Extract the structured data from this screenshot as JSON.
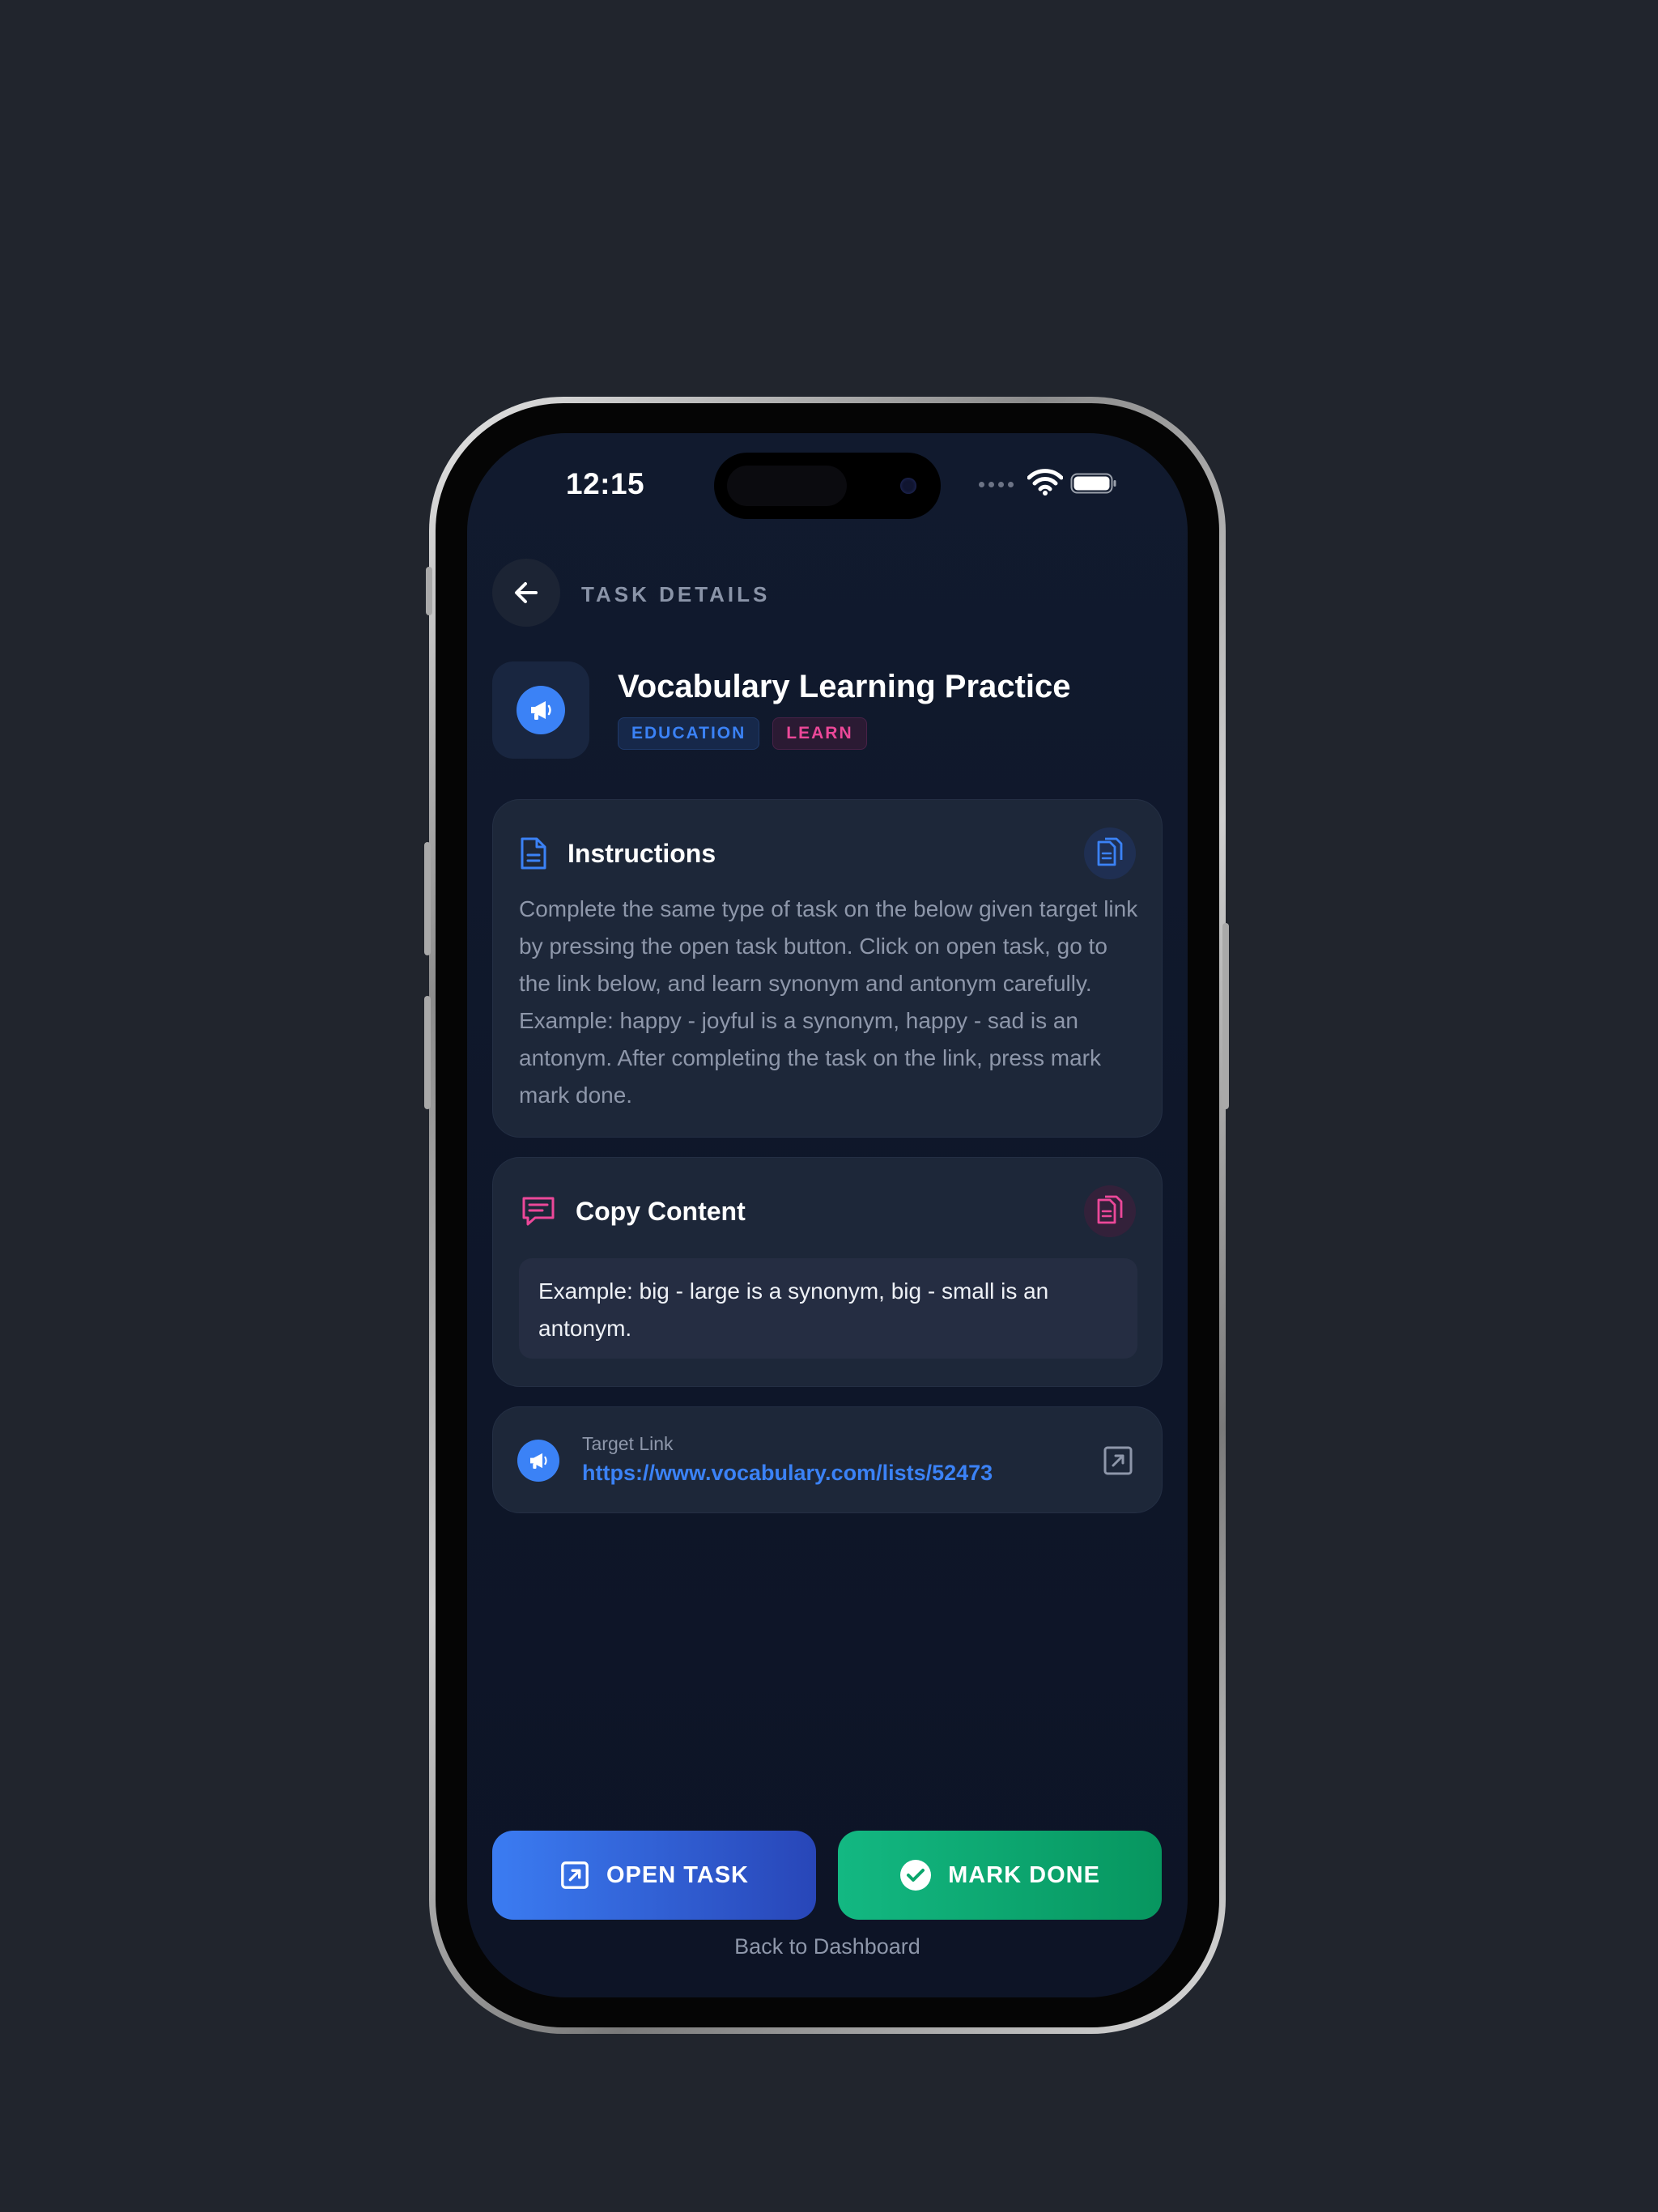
{
  "status_bar": {
    "time": "12:15"
  },
  "header": {
    "label": "TASK DETAILS"
  },
  "task": {
    "title": "Vocabulary Learning Practice",
    "tags": [
      "EDUCATION",
      "LEARN"
    ]
  },
  "instructions": {
    "title": "Instructions",
    "text": "Complete the same type of task on the below given target link by pressing the open task button. Click on open task, go to the link below, and learn synonym and antonym carefully. Example: happy - joyful is a synonym, happy - sad is an antonym. After completing the task on the link, press mark mark done."
  },
  "copy_content": {
    "title": "Copy Content",
    "text": "Example: big - large is a synonym, big - small is an antonym."
  },
  "target_link": {
    "label": "Target Link",
    "url": "https://www.vocabulary.com/lists/52473"
  },
  "actions": {
    "open_task": "OPEN TASK",
    "mark_done": "MARK DONE",
    "back_to_dashboard": "Back to Dashboard"
  },
  "colors": {
    "accent_blue": "#3b82f6",
    "accent_pink": "#ec4899",
    "accent_green": "#10b981",
    "background": "#0f172a"
  },
  "icons": {
    "back": "arrow-left-icon",
    "task": "megaphone-icon",
    "instructions": "document-icon",
    "copy": "copy-icon",
    "copy_content": "chat-lines-icon",
    "external": "external-link-icon",
    "check": "check-circle-icon"
  }
}
